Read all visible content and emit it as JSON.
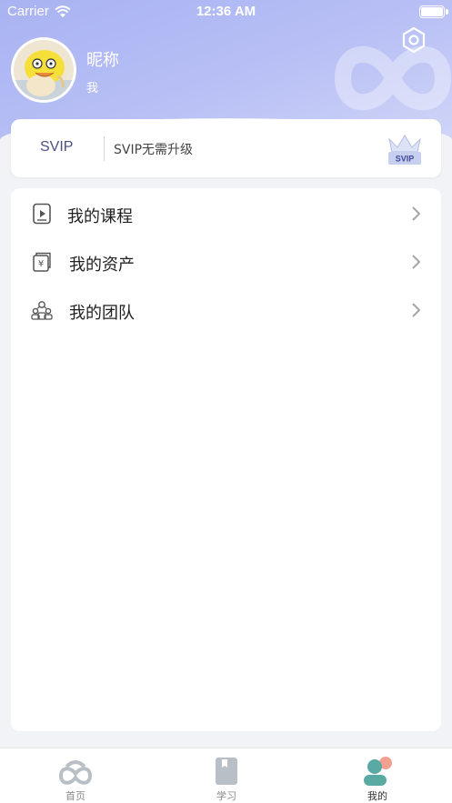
{
  "status_bar": {
    "carrier": "Carrier",
    "time": "12:36 AM"
  },
  "profile": {
    "nickname": "昵称",
    "subtitle": "我"
  },
  "svip": {
    "label": "SVIP",
    "description": "SVIP无需升级",
    "badge_text": "SVIP"
  },
  "menu": {
    "items": [
      {
        "label": "我的课程",
        "icon": "course-play-icon"
      },
      {
        "label": "我的资产",
        "icon": "wallet-yen-icon"
      },
      {
        "label": "我的团队",
        "icon": "team-icon"
      }
    ]
  },
  "tab_bar": {
    "tabs": [
      {
        "label": "首页",
        "icon": "home-infinity-icon",
        "active": false
      },
      {
        "label": "学习",
        "icon": "book-icon",
        "active": false
      },
      {
        "label": "我的",
        "icon": "profile-icon",
        "active": true
      }
    ]
  },
  "colors": {
    "header_gradient_start": "#a9b3f2",
    "accent_teal": "#5aa9a2",
    "accent_coral": "#f08f7f",
    "svip_text": "#4a5180"
  }
}
